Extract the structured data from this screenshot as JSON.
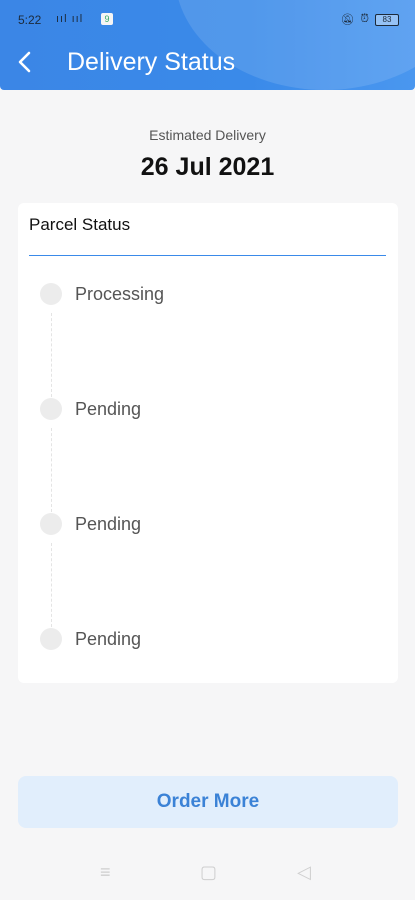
{
  "status_bar": {
    "time": "5:22",
    "signal": "░ıl.ıl",
    "battery": "83"
  },
  "header": {
    "back_icon": "chevron-left-icon",
    "title": "Delivery Status",
    "color": "#3a8ae9"
  },
  "estimate": {
    "label": "Estimated Delivery",
    "date": "26 Jul 2021"
  },
  "parcel": {
    "title": "Parcel Status",
    "steps": [
      {
        "label": "Processing"
      },
      {
        "label": "Pending"
      },
      {
        "label": "Pending"
      },
      {
        "label": "Pending"
      }
    ]
  },
  "actions": {
    "order_more": "Order More"
  }
}
